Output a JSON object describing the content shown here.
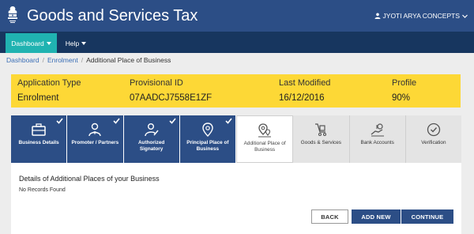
{
  "header": {
    "title": "Goods and Services Tax",
    "user_name": "JYOTI ARYA CONCEPTS"
  },
  "nav": {
    "dashboard": "Dashboard",
    "help": "Help"
  },
  "breadcrumb": [
    "Dashboard",
    "Enrolment",
    "Additional Place of Business"
  ],
  "banner": {
    "application_type_label": "Application Type",
    "application_type_value": "Enrolment",
    "provisional_id_label": "Provisional ID",
    "provisional_id_value": "07AADCJ7558E1ZF",
    "last_modified_label": "Last Modified",
    "last_modified_value": "16/12/2016",
    "profile_label": "Profile",
    "profile_value": "90%"
  },
  "steps": [
    {
      "label": "Business Details",
      "status": "done",
      "icon": "briefcase-icon"
    },
    {
      "label": "Promoter / Partners",
      "status": "done",
      "icon": "person-icon"
    },
    {
      "label": "Authorized Signatory",
      "status": "done",
      "icon": "signatory-icon"
    },
    {
      "label": "Principal Place of Business",
      "status": "done",
      "icon": "location-pin-icon"
    },
    {
      "label": "Additional Place of Business",
      "status": "active",
      "icon": "locations-icon"
    },
    {
      "label": "Goods & Services",
      "status": "todo",
      "icon": "goods-icon"
    },
    {
      "label": "Bank Accounts",
      "status": "todo",
      "icon": "bank-icon"
    },
    {
      "label": "Verification",
      "status": "todo",
      "icon": "verification-icon"
    }
  ],
  "panel": {
    "title": "Details of Additional Places of your Business",
    "empty_text": "No Records Found"
  },
  "buttons": {
    "back": "BACK",
    "add_new": "ADD NEW",
    "continue": "CONTINUE"
  },
  "colors": {
    "header_blue": "#2c4e86",
    "nav_dark": "#17365f",
    "dashboard_teal": "#20b3b1",
    "banner_yellow": "#fdd836"
  }
}
